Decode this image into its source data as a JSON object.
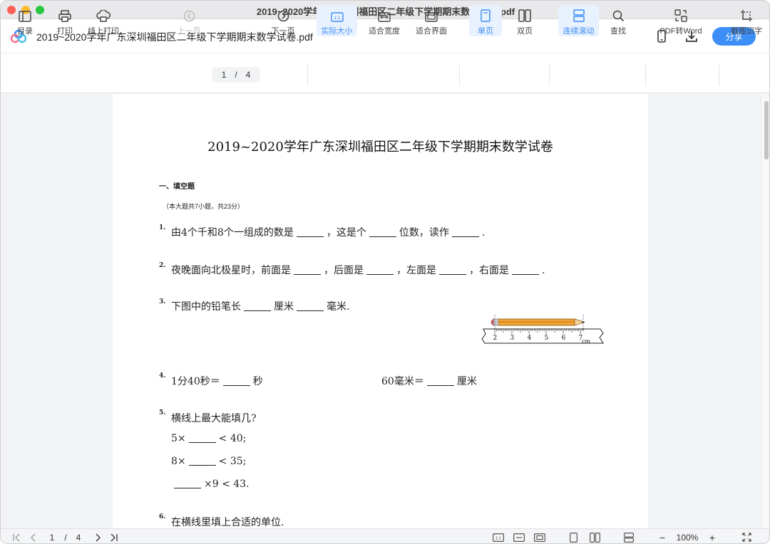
{
  "window": {
    "title": "2019~2020学年广东深圳福田区二年级下学期期末数学试卷.pdf"
  },
  "appbar": {
    "doc_name": "2019~2020学年广东深圳福田区二年级下学期期末数学试卷.pdf",
    "share_label": "分享",
    "icons": [
      "mobile-icon",
      "download-icon"
    ]
  },
  "toolbar": {
    "toc": "目录",
    "print": "打印",
    "online_print": "线上打印",
    "prev_page": "上一页",
    "next_page": "下一页",
    "current_page": "1",
    "page_sep": "/",
    "total_pages": "4",
    "actual_size": "实际大小",
    "actual_size_icon_text": "1:1",
    "fit_width": "适合宽度",
    "fit_page": "适合界面",
    "single_page": "单页",
    "two_page": "双页",
    "continuous_scroll": "连续滚动",
    "find": "查找",
    "pdf_to_word": "PDF转Word",
    "ocr": "截图识字"
  },
  "document": {
    "title": "2019~2020学年广东深圳福田区二年级下学期期末数学试卷",
    "section_heading": "一、填空题",
    "section_note": "（本大题共7小题，共23分）",
    "q1": {
      "num": "1.",
      "a": "由4个千和8个一组成的数是",
      "b": "，这是个",
      "c": "位数，读作",
      "d": "."
    },
    "q2": {
      "num": "2.",
      "a": "夜晚面向北极星时，前面是",
      "b": "，后面是",
      "c": "，左面是",
      "d": "，右面是",
      "e": "."
    },
    "q3": {
      "num": "3.",
      "a": "下图中的铅笔长",
      "b": "厘米",
      "c": "毫米."
    },
    "ruler": {
      "ticks": [
        "2",
        "3",
        "4",
        "5",
        "6",
        "7"
      ],
      "unit": "cm"
    },
    "q4": {
      "num": "4.",
      "a": "1分40秒＝",
      "b": "秒",
      "c": "60毫米＝",
      "d": "厘米"
    },
    "q5": {
      "num": "5.",
      "text": "横线上最大能填几?",
      "line1_a": "5×",
      "line1_b": "< 40;",
      "line2_a": "8×",
      "line2_b": "< 35;",
      "line3_b": "×9 < 43."
    },
    "q6": {
      "num": "6.",
      "text": "在横线里填上合适的单位."
    }
  },
  "statusbar": {
    "current_page": "1",
    "page_sep": "/",
    "total_pages": "4",
    "zoom": "100%",
    "zoom_out": "−",
    "zoom_in": "+",
    "one_to_one": "1:1"
  },
  "colors": {
    "accent": "#3d8ef7",
    "active_bg": "#e8f1fe",
    "close": "#fe5f57",
    "minimize": "#febc2e",
    "maximize": "#28c840"
  }
}
